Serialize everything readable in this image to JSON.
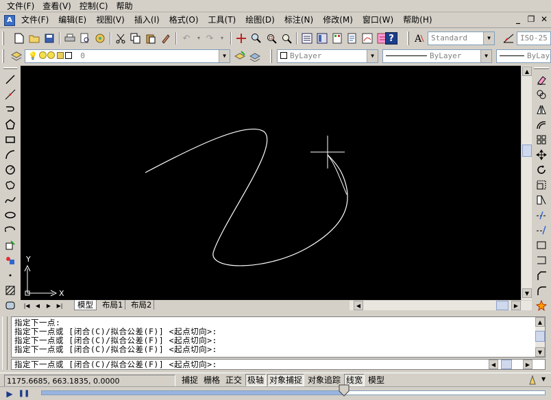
{
  "titlebar": {
    "menus": [
      "文件(F)",
      "查看(V)",
      "控制(C)",
      "帮助"
    ]
  },
  "menubar": {
    "items": [
      "文件(F)",
      "编辑(E)",
      "视图(V)",
      "插入(I)",
      "格式(O)",
      "工具(T)",
      "绘图(D)",
      "标注(N)",
      "修改(M)",
      "窗口(W)",
      "帮助(H)"
    ],
    "window_controls": [
      "_",
      "❐",
      "✕"
    ]
  },
  "toolbar": {
    "text_style": "Standard",
    "dim_style": "ISO-25"
  },
  "layers": {
    "current_layer": "0",
    "color": "ByLayer",
    "linetype": "ByLayer",
    "lineweight": "ByLayer"
  },
  "tabs": [
    "模型",
    "布局1",
    "布局2"
  ],
  "ucs": {
    "x": "X",
    "y": "Y"
  },
  "command": {
    "history": [
      "指定下一点:",
      "指定下一点或 [闭合(C)/拟合公差(F)] <起点切向>:",
      "指定下一点或 [闭合(C)/拟合公差(F)] <起点切向>:",
      "指定下一点或 [闭合(C)/拟合公差(F)] <起点切向>:"
    ],
    "prompt": "指定下一点或 [闭合(C)/拟合公差(F)] <起点切向>:"
  },
  "status": {
    "coords": "1175.6685, 663.1835, 0.0000",
    "toggles": [
      "捕捉",
      "栅格",
      "正交",
      "极轴",
      "对象捕捉",
      "对象追踪",
      "线宽",
      "模型"
    ]
  },
  "player": {
    "play": "▶",
    "pause": "❚❚",
    "progress": 0.6
  }
}
